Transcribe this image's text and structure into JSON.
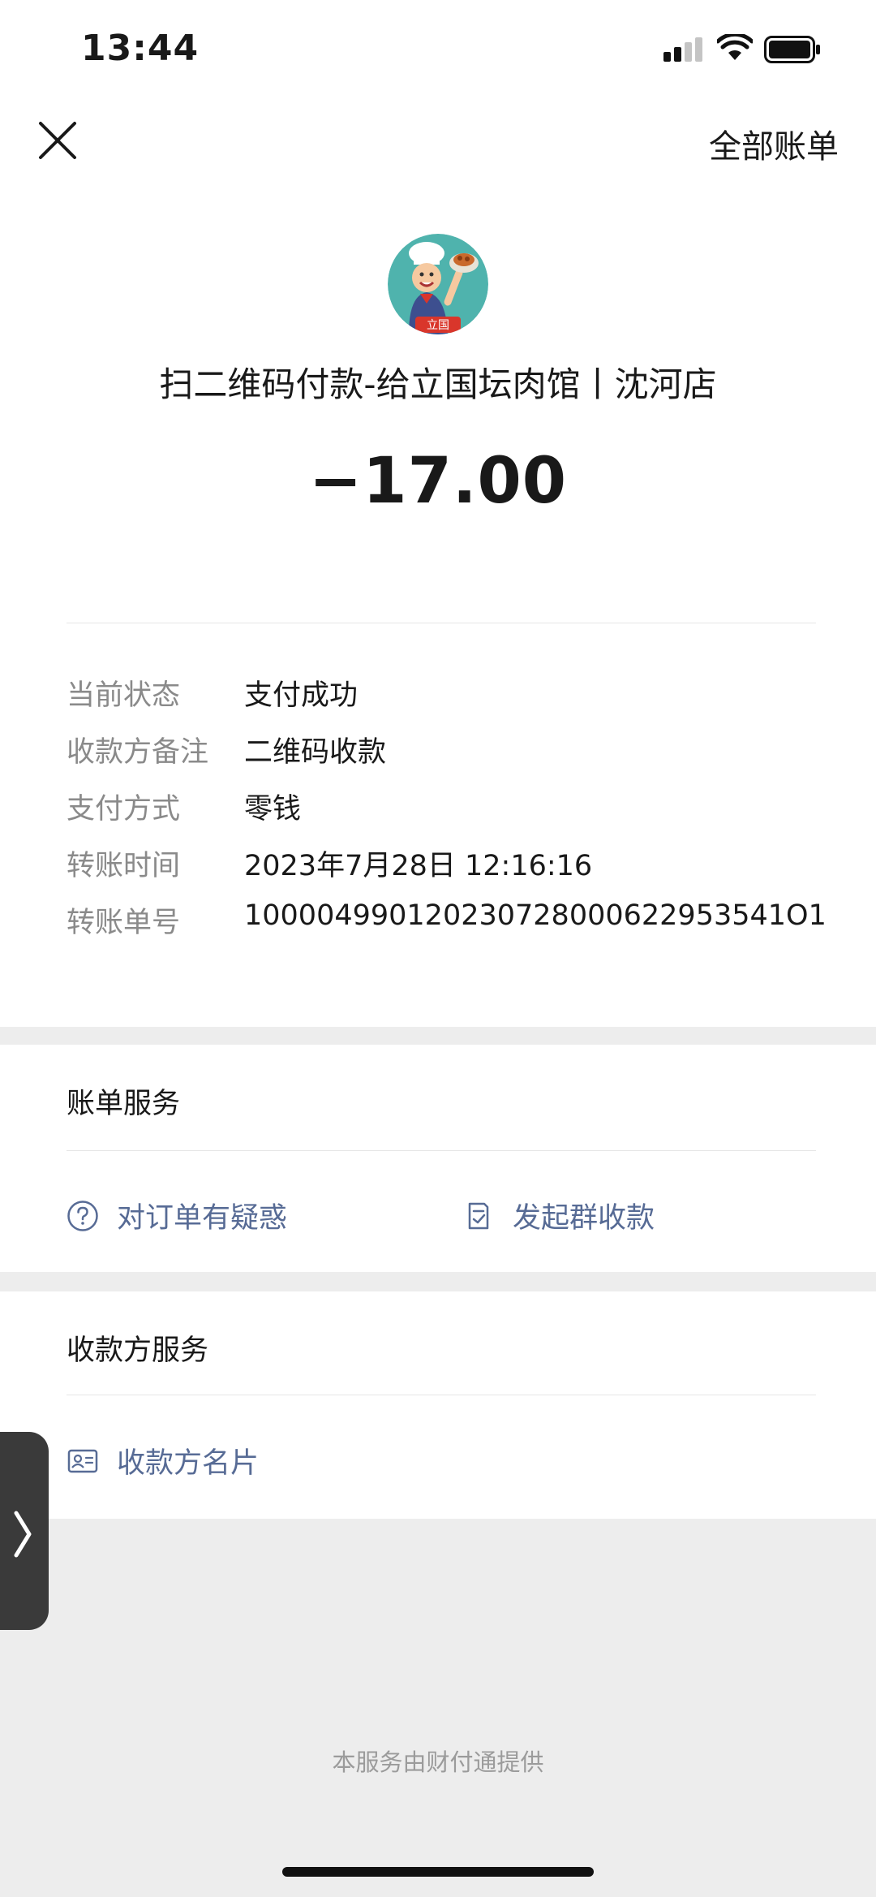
{
  "status_bar": {
    "time": "13:44"
  },
  "nav": {
    "close_icon": "close-icon",
    "all_bills_label": "全部账单"
  },
  "merchant": {
    "avatar_text": "立国",
    "title": "扫二维码付款-给立国坛肉馆丨沈河店"
  },
  "amount": "−17.00",
  "details": [
    {
      "label": "当前状态",
      "value": "支付成功"
    },
    {
      "label": "收款方备注",
      "value": "二维码收款"
    },
    {
      "label": "支付方式",
      "value": "零钱"
    },
    {
      "label": "转账时间",
      "value": "2023年7月28日 12:16:16"
    },
    {
      "label": "转账单号",
      "value": "100004990120230728000622953541O1"
    }
  ],
  "bill_service": {
    "title": "账单服务",
    "actions": [
      {
        "label": "对订单有疑惑",
        "icon": "question-circle-icon"
      },
      {
        "label": "发起群收款",
        "icon": "group-collect-icon"
      }
    ]
  },
  "payee_service": {
    "title": "收款方服务",
    "actions": [
      {
        "label": "收款方名片",
        "icon": "id-card-icon"
      }
    ]
  },
  "footer": "本服务由财付通提供",
  "colors": {
    "link": "#576b95",
    "label": "#8a8a8a",
    "background": "#ededed"
  }
}
